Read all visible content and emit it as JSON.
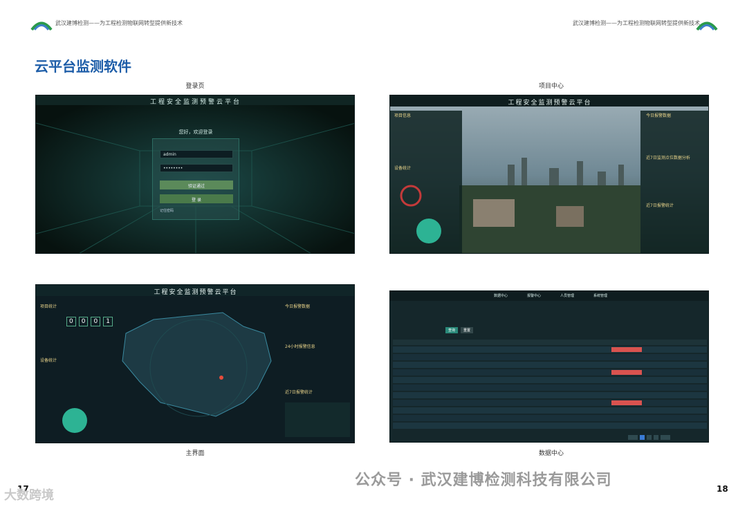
{
  "header": {
    "left": "武汉建博检测——为工程检测物联网转型提供新技术",
    "right": "武汉建博检测——为工程检测物联网转型提供新技术"
  },
  "page_title": "云平台监测软件",
  "captions": [
    "登录页",
    "项目中心",
    "主界面",
    "数据中心"
  ],
  "platform_title": "工程安全监测预警云平台",
  "login": {
    "welcome": "您好，欢迎登录",
    "username": "admin",
    "password": "••••••••",
    "verify_btn": "验证通过",
    "login_btn": "登 录",
    "remember": "记住密码"
  },
  "project": {
    "info_title": "项目信息",
    "device_title": "设备统计",
    "warn_title": "今日报警数据",
    "trend_title": "近7日监测点位数据分析",
    "stat_title": "近7日报警统计"
  },
  "main": {
    "stats_title": "项目统计",
    "device_title": "设备统计",
    "warn_title": "今日报警数据",
    "live_title": "24小时报警信息",
    "seven_title": "近7日报警统计",
    "counter": [
      "0",
      "0",
      "0",
      "1"
    ]
  },
  "data_center": {
    "tabs": [
      "数据中心",
      "报警中心",
      "人员管理",
      "系统管理"
    ],
    "buttons": [
      "查询",
      "重置"
    ],
    "rows": 11
  },
  "page_numbers": {
    "left": "17",
    "right": "18"
  },
  "watermark": "公众号 · 武汉建博检测科技有限公司",
  "watermark2": "大数跨境"
}
